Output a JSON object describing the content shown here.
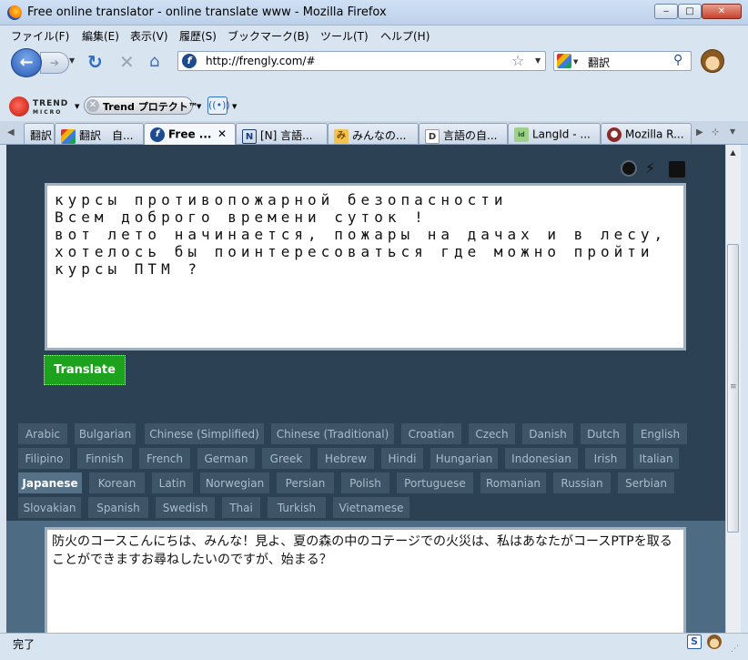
{
  "window": {
    "title": "Free online translator - online translate www - Mozilla Firefox"
  },
  "menu": [
    "ファイル(F)",
    "編集(E)",
    "表示(V)",
    "履歴(S)",
    "ブックマーク(B)",
    "ツール(T)",
    "ヘルプ(H)"
  ],
  "nav": {
    "url": "http://frengly.com/#",
    "search_value": "翻訳"
  },
  "trend": {
    "logo_text": "TREND",
    "logo_sub": "MICRO",
    "protect_label": "Trend プロテクト™"
  },
  "tabs": [
    {
      "label": "翻訳",
      "icon": ""
    },
    {
      "label": "翻訳　自...",
      "icon": "google-icon"
    },
    {
      "label": "Free ...",
      "icon": "frengly-icon"
    },
    {
      "label": "[N] 言語...",
      "icon": "n-icon"
    },
    {
      "label": "みんなの...",
      "icon": "site-icon"
    },
    {
      "label": "言語の自...",
      "icon": "d-icon"
    },
    {
      "label": "LangId - ...",
      "icon": "langid-icon"
    },
    {
      "label": "Mozilla R...",
      "icon": "mozilla-icon"
    }
  ],
  "source_text": "курсы противопожарной безопасности\nВсем доброго времени суток !\nвот лето начинается, пожары на дачах и в лесу,\nхотелось бы поинтересоваться где можно пройти\nкурсы ПТМ ?",
  "translate_label": "Translate",
  "languages": [
    [
      "Arabic",
      "Bulgarian",
      "Chinese (Simplified)",
      "Chinese (Traditional)",
      "Croatian",
      "Czech",
      "Danish",
      "Dutch",
      "English"
    ],
    [
      "Filipino",
      "Finnish",
      "French",
      "German",
      "Greek",
      "Hebrew",
      "Hindi",
      "Hungarian",
      "Indonesian",
      "Irish",
      "Italian"
    ],
    [
      "Japanese",
      "Korean",
      "Latin",
      "Norwegian",
      "Persian",
      "Polish",
      "Portuguese",
      "Romanian",
      "Russian",
      "Serbian"
    ],
    [
      "Slovakian",
      "Spanish",
      "Swedish",
      "Thai",
      "Turkish",
      "Vietnamese"
    ]
  ],
  "selected_language": "Japanese",
  "result_text": "防火のコースこんにちは、みんな！見よ、夏の森の中のコテージでの火災は、私はあなたがコースPTPを取ることができますお尋ねしたいのですが、始まる？",
  "status": {
    "text": "完了"
  }
}
